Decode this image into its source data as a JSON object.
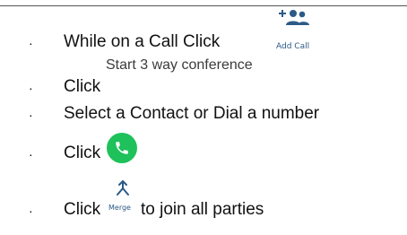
{
  "steps": [
    {
      "bullet": "·",
      "text": "While on a Call Click"
    },
    {
      "bullet": "·",
      "text": "Click"
    },
    {
      "bullet": "·",
      "text": "Select a Contact or Dial a number"
    },
    {
      "bullet": "·",
      "text": "Click"
    },
    {
      "bullet": "·",
      "text": "Click"
    }
  ],
  "add_call": {
    "icon": "add-person-group-icon",
    "label": "Add Call"
  },
  "conference": {
    "label": "Start 3 way conference"
  },
  "call_button": {
    "icon": "phone-icon",
    "color": "#1FC15A"
  },
  "merge": {
    "icon": "merge-arrow-icon",
    "label": "Merge"
  },
  "join_text": "to join all parties",
  "colors": {
    "accent_blue": "#2C5A86",
    "text": "#111111",
    "call_green": "#1FC15A"
  }
}
